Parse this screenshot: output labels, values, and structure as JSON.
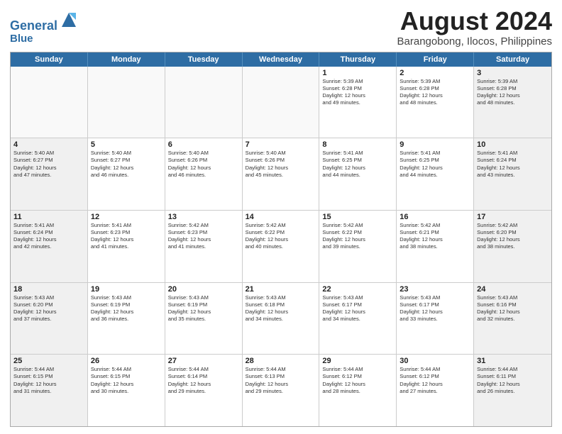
{
  "header": {
    "logo_line1": "General",
    "logo_line2": "Blue",
    "title": "August 2024",
    "subtitle": "Barangobong, Ilocos, Philippines"
  },
  "weekdays": [
    "Sunday",
    "Monday",
    "Tuesday",
    "Wednesday",
    "Thursday",
    "Friday",
    "Saturday"
  ],
  "weeks": [
    [
      {
        "day": "",
        "text": "",
        "empty": true
      },
      {
        "day": "",
        "text": "",
        "empty": true
      },
      {
        "day": "",
        "text": "",
        "empty": true
      },
      {
        "day": "",
        "text": "",
        "empty": true
      },
      {
        "day": "1",
        "text": "Sunrise: 5:39 AM\nSunset: 6:28 PM\nDaylight: 12 hours\nand 49 minutes."
      },
      {
        "day": "2",
        "text": "Sunrise: 5:39 AM\nSunset: 6:28 PM\nDaylight: 12 hours\nand 48 minutes."
      },
      {
        "day": "3",
        "text": "Sunrise: 5:39 AM\nSunset: 6:28 PM\nDaylight: 12 hours\nand 48 minutes."
      }
    ],
    [
      {
        "day": "4",
        "text": "Sunrise: 5:40 AM\nSunset: 6:27 PM\nDaylight: 12 hours\nand 47 minutes."
      },
      {
        "day": "5",
        "text": "Sunrise: 5:40 AM\nSunset: 6:27 PM\nDaylight: 12 hours\nand 46 minutes."
      },
      {
        "day": "6",
        "text": "Sunrise: 5:40 AM\nSunset: 6:26 PM\nDaylight: 12 hours\nand 46 minutes."
      },
      {
        "day": "7",
        "text": "Sunrise: 5:40 AM\nSunset: 6:26 PM\nDaylight: 12 hours\nand 45 minutes."
      },
      {
        "day": "8",
        "text": "Sunrise: 5:41 AM\nSunset: 6:25 PM\nDaylight: 12 hours\nand 44 minutes."
      },
      {
        "day": "9",
        "text": "Sunrise: 5:41 AM\nSunset: 6:25 PM\nDaylight: 12 hours\nand 44 minutes."
      },
      {
        "day": "10",
        "text": "Sunrise: 5:41 AM\nSunset: 6:24 PM\nDaylight: 12 hours\nand 43 minutes."
      }
    ],
    [
      {
        "day": "11",
        "text": "Sunrise: 5:41 AM\nSunset: 6:24 PM\nDaylight: 12 hours\nand 42 minutes."
      },
      {
        "day": "12",
        "text": "Sunrise: 5:41 AM\nSunset: 6:23 PM\nDaylight: 12 hours\nand 41 minutes."
      },
      {
        "day": "13",
        "text": "Sunrise: 5:42 AM\nSunset: 6:23 PM\nDaylight: 12 hours\nand 41 minutes."
      },
      {
        "day": "14",
        "text": "Sunrise: 5:42 AM\nSunset: 6:22 PM\nDaylight: 12 hours\nand 40 minutes."
      },
      {
        "day": "15",
        "text": "Sunrise: 5:42 AM\nSunset: 6:22 PM\nDaylight: 12 hours\nand 39 minutes."
      },
      {
        "day": "16",
        "text": "Sunrise: 5:42 AM\nSunset: 6:21 PM\nDaylight: 12 hours\nand 38 minutes."
      },
      {
        "day": "17",
        "text": "Sunrise: 5:42 AM\nSunset: 6:20 PM\nDaylight: 12 hours\nand 38 minutes."
      }
    ],
    [
      {
        "day": "18",
        "text": "Sunrise: 5:43 AM\nSunset: 6:20 PM\nDaylight: 12 hours\nand 37 minutes."
      },
      {
        "day": "19",
        "text": "Sunrise: 5:43 AM\nSunset: 6:19 PM\nDaylight: 12 hours\nand 36 minutes."
      },
      {
        "day": "20",
        "text": "Sunrise: 5:43 AM\nSunset: 6:19 PM\nDaylight: 12 hours\nand 35 minutes."
      },
      {
        "day": "21",
        "text": "Sunrise: 5:43 AM\nSunset: 6:18 PM\nDaylight: 12 hours\nand 34 minutes."
      },
      {
        "day": "22",
        "text": "Sunrise: 5:43 AM\nSunset: 6:17 PM\nDaylight: 12 hours\nand 34 minutes."
      },
      {
        "day": "23",
        "text": "Sunrise: 5:43 AM\nSunset: 6:17 PM\nDaylight: 12 hours\nand 33 minutes."
      },
      {
        "day": "24",
        "text": "Sunrise: 5:43 AM\nSunset: 6:16 PM\nDaylight: 12 hours\nand 32 minutes."
      }
    ],
    [
      {
        "day": "25",
        "text": "Sunrise: 5:44 AM\nSunset: 6:15 PM\nDaylight: 12 hours\nand 31 minutes."
      },
      {
        "day": "26",
        "text": "Sunrise: 5:44 AM\nSunset: 6:15 PM\nDaylight: 12 hours\nand 30 minutes."
      },
      {
        "day": "27",
        "text": "Sunrise: 5:44 AM\nSunset: 6:14 PM\nDaylight: 12 hours\nand 29 minutes."
      },
      {
        "day": "28",
        "text": "Sunrise: 5:44 AM\nSunset: 6:13 PM\nDaylight: 12 hours\nand 29 minutes."
      },
      {
        "day": "29",
        "text": "Sunrise: 5:44 AM\nSunset: 6:12 PM\nDaylight: 12 hours\nand 28 minutes."
      },
      {
        "day": "30",
        "text": "Sunrise: 5:44 AM\nSunset: 6:12 PM\nDaylight: 12 hours\nand 27 minutes."
      },
      {
        "day": "31",
        "text": "Sunrise: 5:44 AM\nSunset: 6:11 PM\nDaylight: 12 hours\nand 26 minutes."
      }
    ]
  ]
}
